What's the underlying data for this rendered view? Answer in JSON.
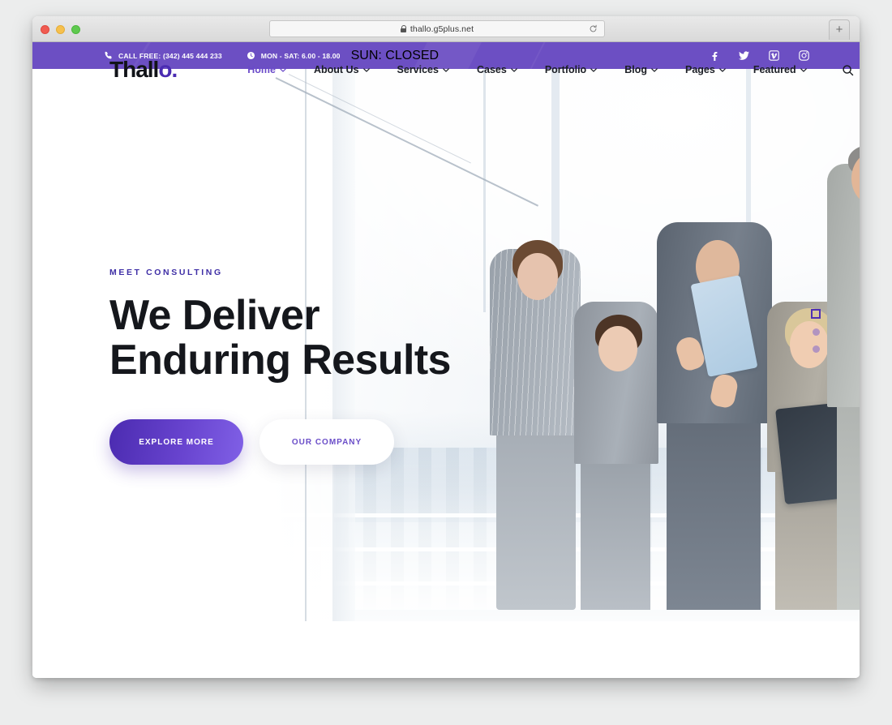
{
  "browser": {
    "url": "thallo.g5plus.net",
    "lock_icon": "lock-icon",
    "reload_icon": "reload-icon",
    "newtab_label": "+",
    "traffic_lights": [
      "close",
      "minimize",
      "zoom"
    ]
  },
  "topbar": {
    "phone_icon": "phone-icon",
    "phone_text": "CALL FREE: (342) 445 444 233",
    "clock_icon": "clock-icon",
    "hours_weekday": "MON - SAT: 6.00 - 18.00",
    "hours_sunday": "SUN: CLOSED",
    "social": [
      {
        "name": "facebook-icon",
        "label": "Facebook"
      },
      {
        "name": "twitter-icon",
        "label": "Twitter"
      },
      {
        "name": "vimeo-icon",
        "label": "Vimeo"
      },
      {
        "name": "instagram-icon",
        "label": "Instagram"
      }
    ],
    "background_color": "#6c4fc3"
  },
  "header": {
    "logo_main": "Thall",
    "logo_accent": "o.",
    "nav": [
      {
        "label": "Home",
        "active": true,
        "has_dropdown": true
      },
      {
        "label": "About Us",
        "active": false,
        "has_dropdown": true
      },
      {
        "label": "Services",
        "active": false,
        "has_dropdown": true
      },
      {
        "label": "Cases",
        "active": false,
        "has_dropdown": true
      },
      {
        "label": "Portfolio",
        "active": false,
        "has_dropdown": true
      },
      {
        "label": "Blog",
        "active": false,
        "has_dropdown": true
      },
      {
        "label": "Pages",
        "active": false,
        "has_dropdown": true
      },
      {
        "label": "Featured",
        "active": false,
        "has_dropdown": true
      }
    ],
    "search_icon": "search-icon",
    "active_color": "#6a4ac9"
  },
  "hero": {
    "eyebrow": "MEET CONSULTING",
    "eyebrow_color": "#3f2fa6",
    "title": "We Deliver\nEnduring Results",
    "primary_button": "EXPLORE MORE",
    "secondary_button": "OUR COMPANY",
    "primary_gradient_from": "#4b2bb0",
    "primary_gradient_to": "#8060e6",
    "secondary_text_color": "#6a4dc8",
    "slider": {
      "active_index": 0,
      "items": [
        "slide-1",
        "slide-2",
        "slide-3"
      ]
    },
    "image_alt": "Five business people in a bright office discussing over a tablet"
  }
}
